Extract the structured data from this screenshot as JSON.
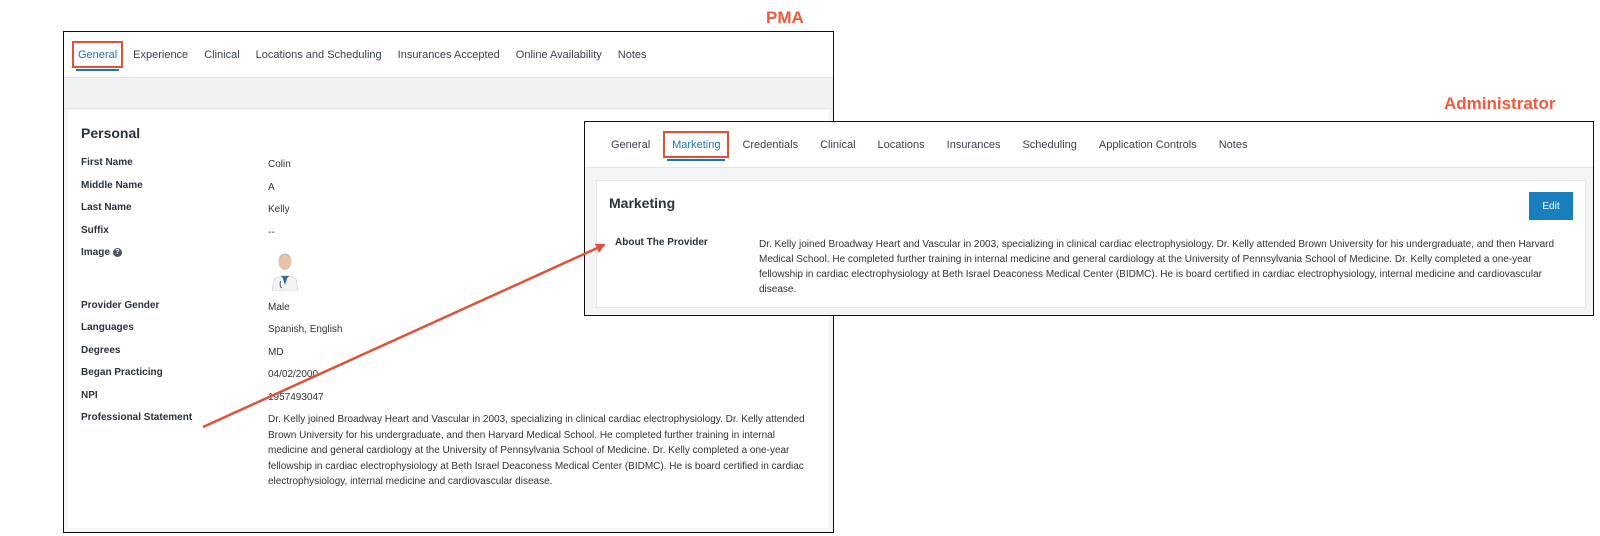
{
  "callouts": {
    "pma": "PMA",
    "admin": "Administrator"
  },
  "pma": {
    "tabs": [
      {
        "label": "General",
        "active": true
      },
      {
        "label": "Experience"
      },
      {
        "label": "Clinical"
      },
      {
        "label": "Locations and Scheduling"
      },
      {
        "label": "Insurances Accepted"
      },
      {
        "label": "Online Availability"
      },
      {
        "label": "Notes"
      }
    ],
    "section_title": "Personal",
    "fields": [
      {
        "key": "First Name",
        "value": "Colin"
      },
      {
        "key": "Middle Name",
        "value": "A"
      },
      {
        "key": "Last Name",
        "value": "Kelly"
      },
      {
        "key": "Suffix",
        "value": "--"
      },
      {
        "key": "Image",
        "value": ""
      },
      {
        "key": "Provider Gender",
        "value": "Male"
      },
      {
        "key": "Languages",
        "value": "Spanish, English"
      },
      {
        "key": "Degrees",
        "value": "MD"
      },
      {
        "key": "Began Practicing",
        "value": "04/02/2000"
      },
      {
        "key": "NPI",
        "value": "1957493047"
      },
      {
        "key": "Professional Statement",
        "value": "Dr. Kelly joined Broadway Heart and Vascular in 2003, specializing in clinical cardiac electrophysiology. Dr. Kelly attended Brown University for his undergraduate, and then Harvard Medical School. He completed further training in internal medicine and general cardiology at the University of Pennsylvania School of Medicine. Dr. Kelly completed a one-year fellowship in cardiac electrophysiology at Beth Israel Deaconess Medical Center (BIDMC). He is board certified in cardiac electrophysiology, internal medicine and cardiovascular disease."
      }
    ],
    "help_icon_glyph": "?"
  },
  "admin": {
    "tabs": [
      {
        "label": "General"
      },
      {
        "label": "Marketing",
        "active": true
      },
      {
        "label": "Credentials"
      },
      {
        "label": "Clinical"
      },
      {
        "label": "Locations"
      },
      {
        "label": "Insurances"
      },
      {
        "label": "Scheduling"
      },
      {
        "label": "Application Controls"
      },
      {
        "label": "Notes"
      }
    ],
    "section_title": "Marketing",
    "edit_label": "Edit",
    "about_key": "About The Provider",
    "about_value": "Dr. Kelly joined Broadway Heart and Vascular in 2003, specializing in clinical cardiac electrophysiology. Dr. Kelly attended Brown University for his undergraduate, and then Harvard Medical School. He completed further training in internal medicine and general cardiology at the University of Pennsylvania School of Medicine. Dr. Kelly completed a one-year fellowship in cardiac electrophysiology at Beth Israel Deaconess Medical Center (BIDMC). He is board certified in cardiac electrophysiology, internal medicine and cardiovascular disease."
  },
  "colors": {
    "accent": "#2273b6",
    "highlight": "#e0523a",
    "callout": "#ef5a3c",
    "button": "#1a7fbf"
  }
}
